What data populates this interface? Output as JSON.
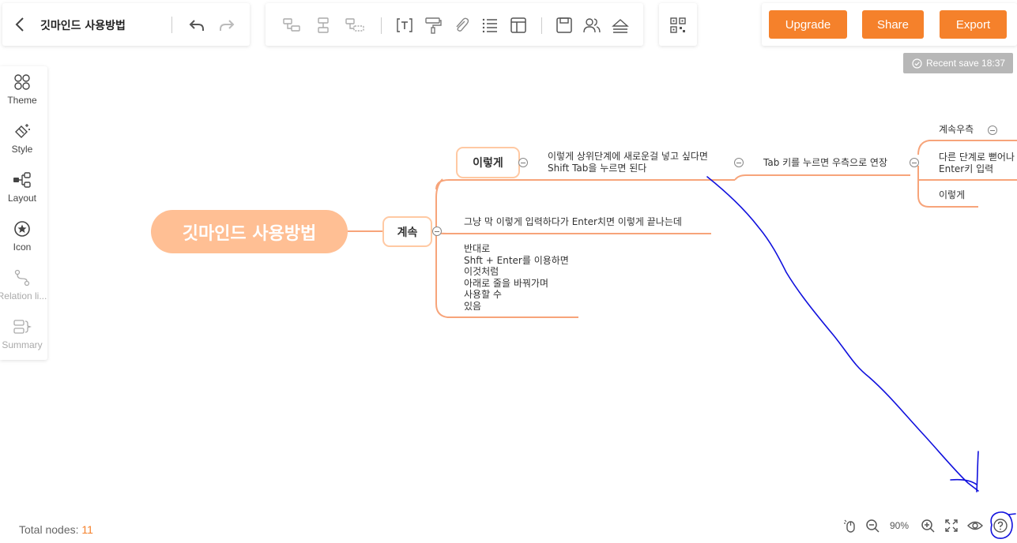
{
  "document": {
    "title": "깃마인드 사용방법"
  },
  "toolbar": {
    "tools": [
      "add-child-node-icon",
      "add-sibling-node-icon",
      "add-parent-node-icon",
      "text-icon",
      "format-painter-icon",
      "attachment-icon",
      "list-icon",
      "layout-icon",
      "save-icon",
      "collaborators-icon",
      "eject-icon",
      "qr-code-icon"
    ]
  },
  "actions": {
    "upgrade": "Upgrade",
    "share": "Share",
    "export": "Export"
  },
  "status": {
    "recent_save": "Recent save 18:37"
  },
  "sidebar": {
    "items": [
      {
        "label": "Theme",
        "icon": "theme-icon"
      },
      {
        "label": "Style",
        "icon": "style-icon"
      },
      {
        "label": "Layout",
        "icon": "layout-icon"
      },
      {
        "label": "Icon",
        "icon": "star-icon"
      },
      {
        "label": "Relation li...",
        "icon": "relation-line-icon"
      },
      {
        "label": "Summary",
        "icon": "summary-icon"
      }
    ]
  },
  "mindmap": {
    "root": "깃마인드 사용방법",
    "continue_node": "계속",
    "this_way_node": "이렇게",
    "upper_note_line1": "이렇게 상위단계에 새로운걸 넣고 싶다면",
    "upper_note_line2": "Shift Tab을 누르면 된다",
    "tab_note": "Tab 키를 누르면 우측으로 연장",
    "right_continue": "계속우측",
    "other_branch_line1": "다른 단계로 뻗어나",
    "other_branch_line2": "Enter키 입력",
    "this_way_leaf": "이렇게",
    "enter_note": "그냥 막 이렇게 입력하다가 Enter치면 이렇게 끝나는데",
    "multiline_note": [
      "반대로",
      "Shft + Enter를 이용하면",
      "이것처럼",
      "아래로 줄을 바꿔가며",
      "사용할 수",
      "있음"
    ]
  },
  "footer": {
    "total_nodes_label": "Total nodes:",
    "total_nodes_count": "11",
    "zoom": "90%"
  },
  "colors": {
    "accent": "#f5812b",
    "root_fill": "#ffbf94",
    "branch_line": "#f7a47a",
    "annotation": "#1010dd"
  }
}
